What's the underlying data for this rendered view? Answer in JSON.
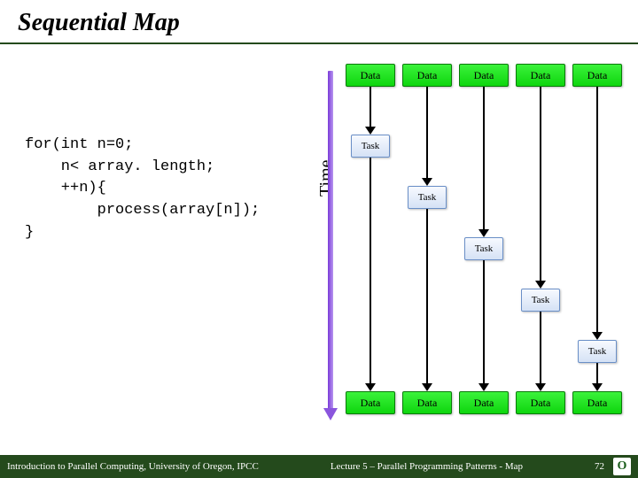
{
  "title": "Sequential Map",
  "code_lines": [
    "for(int n=0;",
    "    n< array. length;",
    "    ++n){",
    "        process(array[n]);",
    "}"
  ],
  "time_label": "Time",
  "labels": {
    "data": "Data",
    "task": "Task"
  },
  "columns": 5,
  "task_offsets": [
    0,
    1,
    2,
    3,
    4
  ],
  "footer": {
    "left": "Introduction to Parallel Computing, University of Oregon, IPCC",
    "mid": "Lecture 5 – Parallel Programming Patterns - Map",
    "page": "72",
    "logo_letter": "O"
  },
  "colors": {
    "accent_bar": "#244a1c",
    "data_box": "#1ee018",
    "task_box": "#e4ecf8",
    "arrow": "#8a55dd"
  }
}
